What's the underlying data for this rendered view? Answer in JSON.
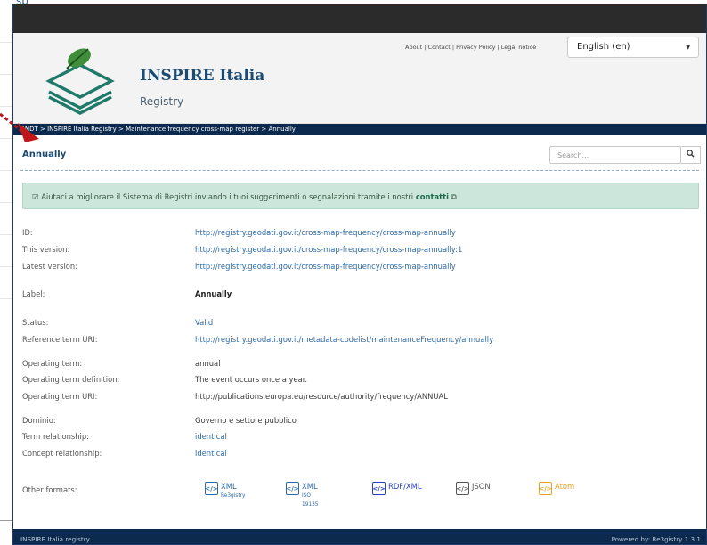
{
  "backdrop": {
    "link_fragment": "sp"
  },
  "top_links": "About | Contact | Privacy Policy | Legal notice",
  "language": {
    "selected": "English (en)"
  },
  "site": {
    "title": "INSPIRE Italia",
    "subtitle": "Registry"
  },
  "breadcrumb": "RNDT > INSPIRE Italia Registry > Maintenance frequency cross-map register > Annually",
  "page": {
    "title": "Annually"
  },
  "search": {
    "placeholder": "Search..."
  },
  "notice": {
    "text": "Aiutaci a migliorare il Sistema di Registri inviando i tuoi suggerimenti o segnalazioni tramite i nostri",
    "link": "contatti"
  },
  "fields": [
    {
      "key": "ID:",
      "value": "http://registry.geodati.gov.it/cross-map-frequency/cross-map-annually",
      "style": "link"
    },
    {
      "key": "This version:",
      "value": "http://registry.geodati.gov.it/cross-map-frequency/cross-map-annually:1",
      "style": "link"
    },
    {
      "key": "Latest version:",
      "value": "http://registry.geodati.gov.it/cross-map-frequency/cross-map-annually",
      "style": "link"
    },
    {
      "key": "Label:",
      "value": "Annually",
      "style": "bold"
    },
    {
      "key": "Status:",
      "value": "Valid",
      "style": "link"
    },
    {
      "key": "Reference term URI:",
      "value": "http://registry.geodati.gov.it/metadata-codelist/maintenanceFrequency/annually",
      "style": "link"
    },
    {
      "key": "Operating term:",
      "value": "annual",
      "style": "plain"
    },
    {
      "key": "Operating term definition:",
      "value": "The event occurs once a year.",
      "style": "plain"
    },
    {
      "key": "Operating term URI:",
      "value": "http://publications.europa.eu/resource/authority/frequency/ANNUAL",
      "style": "plain"
    },
    {
      "key": "Dominio:",
      "value": "Governo e settore pubblico",
      "style": "plain"
    },
    {
      "key": "Term relationship:",
      "value": "identical",
      "style": "link"
    },
    {
      "key": "Concept relationship:",
      "value": "identical",
      "style": "link"
    }
  ],
  "other_formats": {
    "label": "Other formats:",
    "items": [
      {
        "name": "XML",
        "sub": "Re3gistry",
        "color": "#2e6aa7"
      },
      {
        "name": "XML",
        "sub": "ISO 19135",
        "color": "#2e6aa7"
      },
      {
        "name": "RDF/XML",
        "sub": "",
        "color": "#2a3fbf"
      },
      {
        "name": "JSON",
        "sub": "",
        "color": "#555555"
      },
      {
        "name": "Atom",
        "sub": "",
        "color": "#e8a020"
      }
    ]
  },
  "footer": {
    "left": "INSPIRE Italia registry",
    "right": "Powered by: Re3gistry 1.3.1"
  },
  "colors": {
    "navy": "#0c2a4e",
    "accent": "#1b4b73",
    "link": "#2e6aa7",
    "notice_bg": "#cde6dc",
    "arrow": "#c0171b"
  }
}
